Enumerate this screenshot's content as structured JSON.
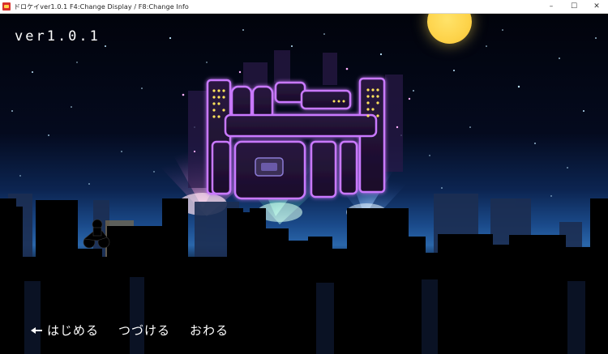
{
  "window": {
    "title": "ドロケイver1.0.1    F4:Change Display / F8:Change Info",
    "controls": {
      "minimize": "–",
      "maximize": "☐",
      "close": "✕"
    }
  },
  "game": {
    "version": "ver1.0.1",
    "menu": {
      "items": [
        "はじめる",
        "つづける",
        "おわる"
      ],
      "selected_index": 0
    }
  },
  "colors": {
    "moon": "#fdd34a",
    "neon_logo": "#c979ff",
    "neon_logo_glow": "#8a2be2",
    "sky_horizon": "#2a66aa",
    "spotlight_pink": "#ffb3d9",
    "spotlight_cyan": "#7fffd4",
    "spotlight_blue": "#9fd1ff"
  },
  "icons": {
    "app": "game-app-icon",
    "cursor": "left-arrow-cursor-icon"
  }
}
